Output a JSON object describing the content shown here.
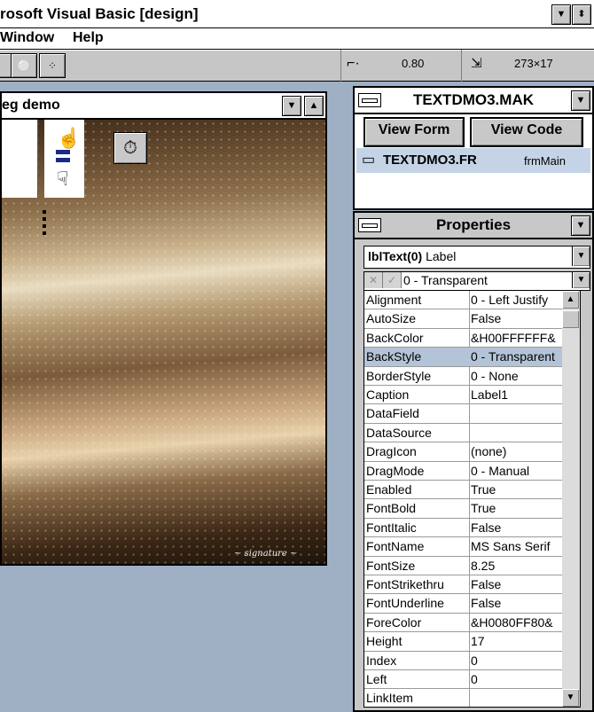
{
  "app": {
    "title": "rosoft Visual Basic [design]",
    "menu": [
      "Window",
      "Help"
    ],
    "toolbar": {
      "position_readout": "0.80",
      "size_readout": "273×17"
    }
  },
  "form_window": {
    "title": "eg demo"
  },
  "project_window": {
    "title": "TEXTDMO3.MAK",
    "view_form_label": "View Form",
    "view_code_label": "View Code",
    "file_name": "TEXTDMO3.FR",
    "form_name": "frmMain"
  },
  "properties_window": {
    "title": "Properties",
    "object": {
      "name": "lblText(0)",
      "type": "Label"
    },
    "edit_value": "0 - Transparent",
    "selected_property": "BackStyle",
    "rows": [
      {
        "name": "Alignment",
        "value": "0 - Left Justify"
      },
      {
        "name": "AutoSize",
        "value": "False"
      },
      {
        "name": "BackColor",
        "value": "&H00FFFFFF&"
      },
      {
        "name": "BackStyle",
        "value": "0 - Transparent"
      },
      {
        "name": "BorderStyle",
        "value": "0 - None"
      },
      {
        "name": "Caption",
        "value": "Label1"
      },
      {
        "name": "DataField",
        "value": ""
      },
      {
        "name": "DataSource",
        "value": ""
      },
      {
        "name": "DragIcon",
        "value": "(none)"
      },
      {
        "name": "DragMode",
        "value": "0 - Manual"
      },
      {
        "name": "Enabled",
        "value": "True"
      },
      {
        "name": "FontBold",
        "value": "True"
      },
      {
        "name": "FontItalic",
        "value": "False"
      },
      {
        "name": "FontName",
        "value": "MS Sans Serif"
      },
      {
        "name": "FontSize",
        "value": "8.25"
      },
      {
        "name": "FontStrikethru",
        "value": "False"
      },
      {
        "name": "FontUnderline",
        "value": "False"
      },
      {
        "name": "ForeColor",
        "value": "&H0080FF80&"
      },
      {
        "name": "Height",
        "value": "17"
      },
      {
        "name": "Index",
        "value": "0"
      },
      {
        "name": "Left",
        "value": "0"
      },
      {
        "name": "LinkItem",
        "value": ""
      }
    ]
  },
  "colors": {
    "desktop": "#9fb0c4",
    "selection": "#b4c4d8",
    "face": "#c8c8c8"
  }
}
